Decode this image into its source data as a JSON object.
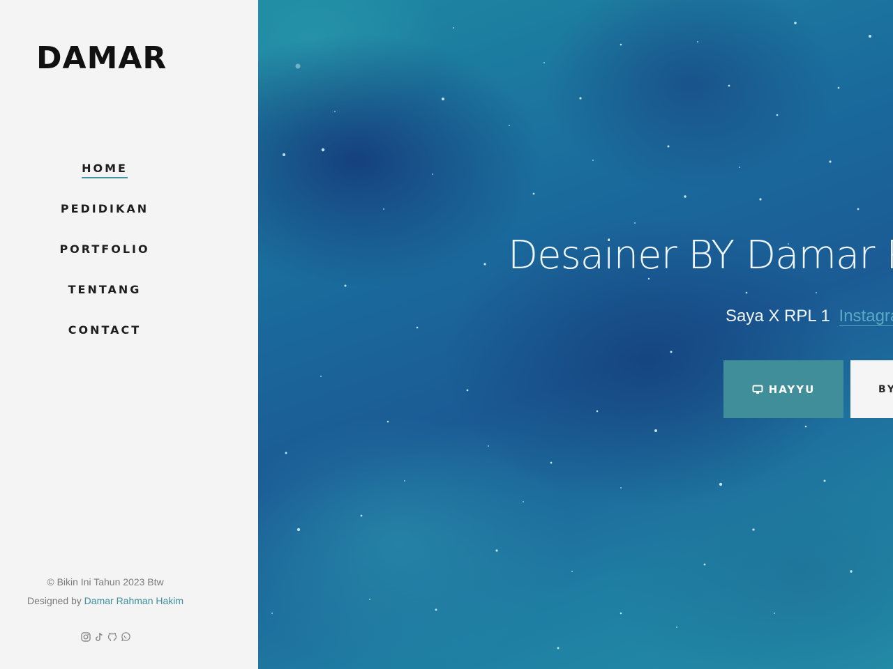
{
  "sidebar": {
    "brand": "DAMAR",
    "nav": [
      {
        "label": "HOME",
        "active": true
      },
      {
        "label": "PEDIDIKAN",
        "active": false
      },
      {
        "label": "PORTFOLIO",
        "active": false
      },
      {
        "label": "TENTANG",
        "active": false
      },
      {
        "label": "CONTACT",
        "active": false
      }
    ],
    "footer": {
      "copyright": "© Bikin Ini Tahun 2023 Btw",
      "designed_by_prefix": "Designed by",
      "designer_name": "Damar Rahman Hakim"
    },
    "socials": [
      "instagram-icon",
      "tiktok-icon",
      "github-icon",
      "whatsapp-icon"
    ]
  },
  "hero": {
    "title": "Desainer BY Damar R",
    "subtitle": "Saya X RPL 1",
    "subtitle_link": "Instagra",
    "primary_button": {
      "icon": "monitor-icon",
      "label": "HAYYU"
    },
    "secondary_button": {
      "label": "BY"
    }
  },
  "colors": {
    "accent": "#3f8e9a",
    "sidebar_bg": "#f4f4f4",
    "link": "#3d8f9c",
    "hero_base": "#1b6a9c"
  }
}
